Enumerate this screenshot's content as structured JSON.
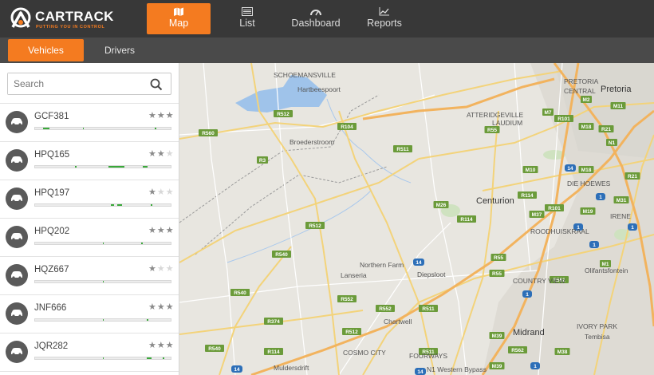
{
  "app": {
    "brand": "CARTRACK",
    "tagline": "PUTTING YOU IN CONTROL",
    "accent": "#f47b20"
  },
  "nav": [
    {
      "label": "Map",
      "icon": "map-icon",
      "active": true
    },
    {
      "label": "List",
      "icon": "list-icon",
      "active": false
    },
    {
      "label": "Dashboard",
      "icon": "dashboard-icon",
      "active": false
    },
    {
      "label": "Reports",
      "icon": "reports-icon",
      "active": false
    }
  ],
  "subtabs": [
    {
      "label": "Vehicles",
      "active": true
    },
    {
      "label": "Drivers",
      "active": false
    }
  ],
  "search": {
    "placeholder": "Search"
  },
  "vehicles": [
    {
      "reg": "GCF381",
      "rating": 3
    },
    {
      "reg": "HPQ165",
      "rating": 2
    },
    {
      "reg": "HPQ197",
      "rating": 1
    },
    {
      "reg": "HPQ202",
      "rating": 3
    },
    {
      "reg": "HQZ667",
      "rating": 1
    },
    {
      "reg": "JNF666",
      "rating": 3
    },
    {
      "reg": "JQR282",
      "rating": 3
    }
  ],
  "map": {
    "places": [
      {
        "name": "SCHOEMANSVILLE",
        "size": "s"
      },
      {
        "name": "Hartbeespoort",
        "size": "m"
      },
      {
        "name": "Broederstroom",
        "size": "m"
      },
      {
        "name": "ATTERIDGEVILLE",
        "size": "s"
      },
      {
        "name": "LAUDIUM",
        "size": "s"
      },
      {
        "name": "PRETORIA",
        "size": "s"
      },
      {
        "name": "CENTRAL",
        "size": "s"
      },
      {
        "name": "Pretoria",
        "size": "l"
      },
      {
        "name": "DIE HOEWES",
        "size": "s"
      },
      {
        "name": "IRENE",
        "size": "s"
      },
      {
        "name": "Centurion",
        "size": "l"
      },
      {
        "name": "ROODHUISKRAAL",
        "size": "s"
      },
      {
        "name": "Northern Farm",
        "size": "m"
      },
      {
        "name": "Lanseria",
        "size": "m"
      },
      {
        "name": "Diepsloot",
        "size": "m"
      },
      {
        "name": "COUNTRY VIEW",
        "size": "s"
      },
      {
        "name": "Olifantsfontein",
        "size": "m"
      },
      {
        "name": "Chartwell",
        "size": "m"
      },
      {
        "name": "Midrand",
        "size": "l"
      },
      {
        "name": "IVORY PARK",
        "size": "s"
      },
      {
        "name": "Tembisa",
        "size": "m"
      },
      {
        "name": "COSMO CITY",
        "size": "s"
      },
      {
        "name": "FOURWAYS",
        "size": "s"
      },
      {
        "name": "Muldersdrift",
        "size": "m"
      },
      {
        "name": "N1 Western Bypass",
        "size": "s"
      }
    ],
    "road_labels": [
      "R560",
      "R512",
      "R104",
      "R511",
      "R3",
      "R55",
      "M7",
      "R101",
      "M2",
      "M18",
      "M11",
      "R21",
      "N1",
      "M10",
      "M18",
      "M26",
      "R114",
      "M37",
      "R101",
      "M31",
      "M19",
      "R21",
      "R114",
      "R512",
      "R540",
      "R512",
      "R55",
      "R562",
      "M1",
      "R540",
      "R552",
      "R552",
      "R511",
      "R55",
      "R374",
      "R512",
      "M39",
      "R562",
      "R540",
      "R114",
      "R511",
      "M38",
      "M39",
      "14",
      "14",
      "14",
      "14",
      "1",
      "1",
      "1",
      "1",
      "1",
      "1"
    ]
  }
}
